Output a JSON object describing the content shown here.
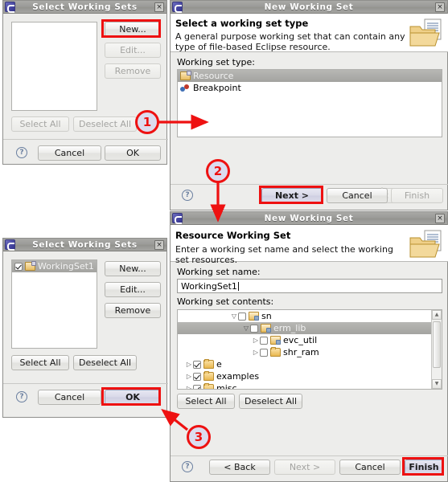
{
  "app": "Eclipse working set wizard walkthrough",
  "dialogs": {
    "select_ws_empty": {
      "title": "Select Working Sets",
      "close_label": "×",
      "list_items": [],
      "buttons": {
        "new": "New...",
        "edit": "Edit...",
        "remove": "Remove",
        "select_all": "Select All",
        "deselect_all": "Deselect All",
        "cancel": "Cancel",
        "ok": "OK",
        "help": "?"
      }
    },
    "new_ws_type": {
      "title": "New Working Set",
      "close_label": "×",
      "header_title": "Select a working set type",
      "header_desc": "A general purpose working set that can contain any type of file-based Eclipse resource.",
      "type_label": "Working set type:",
      "types": [
        {
          "label": "Resource",
          "icon": "working-set-icon",
          "selected": true
        },
        {
          "label": "Breakpoint",
          "icon": "breakpoint-icon",
          "selected": false
        }
      ],
      "buttons": {
        "back": "< Back",
        "next": "Next >",
        "cancel": "Cancel",
        "finish": "Finish",
        "help": "?"
      }
    },
    "select_ws_filled": {
      "title": "Select Working Sets",
      "close_label": "×",
      "list_items": [
        {
          "label": "WorkingSet1",
          "checked": true,
          "selected": true,
          "icon": "working-set-icon"
        }
      ],
      "buttons": {
        "new": "New...",
        "edit": "Edit...",
        "remove": "Remove",
        "select_all": "Select All",
        "deselect_all": "Deselect All",
        "cancel": "Cancel",
        "ok": "OK",
        "help": "?"
      }
    },
    "new_ws_resource": {
      "title": "New Working Set",
      "close_label": "×",
      "header_title": "Resource Working Set",
      "header_desc": "Enter a working set name and select the working set resources.",
      "name_label": "Working set name:",
      "name_value": "WorkingSet1",
      "contents_label": "Working set contents:",
      "tree": [
        {
          "label": "sn",
          "indent": 5,
          "twisty": "▽",
          "checked": false,
          "selected": false,
          "icon": "project-icon"
        },
        {
          "label": "erm_lib",
          "indent": 6,
          "twisty": "▽",
          "checked": false,
          "selected": true,
          "icon": "project-icon"
        },
        {
          "label": "evc_util",
          "indent": 7,
          "twisty": "▷",
          "checked": false,
          "selected": false,
          "icon": "project-icon"
        },
        {
          "label": "shr_ram",
          "indent": 7,
          "twisty": "▷",
          "checked": false,
          "selected": false,
          "icon": "folder-icon"
        },
        {
          "label": "e",
          "indent": 1,
          "twisty": "▷",
          "checked": true,
          "selected": false,
          "icon": "folder-icon"
        },
        {
          "label": "examples",
          "indent": 1,
          "twisty": "▷",
          "checked": true,
          "selected": false,
          "icon": "folder-icon"
        },
        {
          "label": "misc",
          "indent": 1,
          "twisty": "▷",
          "checked": true,
          "selected": false,
          "icon": "folder-icon"
        }
      ],
      "buttons": {
        "select_all": "Select All",
        "deselect_all": "Deselect All",
        "back": "< Back",
        "next": "Next >",
        "cancel": "Cancel",
        "finish": "Finish",
        "help": "?"
      }
    }
  },
  "annotations": {
    "markers": [
      {
        "id": "1",
        "label": "1"
      },
      {
        "id": "2",
        "label": "2"
      },
      {
        "id": "3",
        "label": "3"
      }
    ],
    "highlight_color": "#ee1111",
    "highlighted": [
      "New...",
      "Next >",
      "OK",
      "Finish"
    ]
  }
}
